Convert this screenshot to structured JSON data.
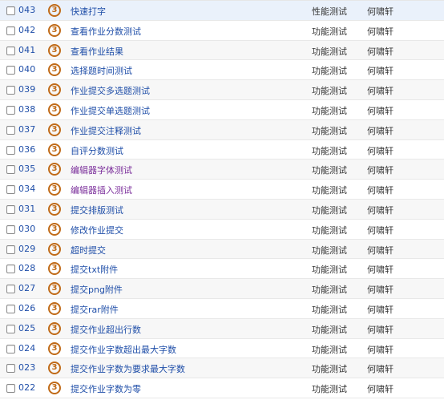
{
  "rows": [
    {
      "id": "043",
      "priority": "3",
      "title": "快速打字",
      "type": "性能测试",
      "owner": "何啸轩",
      "visited": false
    },
    {
      "id": "042",
      "priority": "3",
      "title": "查看作业分数测试",
      "type": "功能测试",
      "owner": "何啸轩",
      "visited": false
    },
    {
      "id": "041",
      "priority": "3",
      "title": "查看作业结果",
      "type": "功能测试",
      "owner": "何啸轩",
      "visited": false
    },
    {
      "id": "040",
      "priority": "3",
      "title": "选择题时间测试",
      "type": "功能测试",
      "owner": "何啸轩",
      "visited": false
    },
    {
      "id": "039",
      "priority": "3",
      "title": "作业提交多选题测试",
      "type": "功能测试",
      "owner": "何啸轩",
      "visited": false
    },
    {
      "id": "038",
      "priority": "3",
      "title": "作业提交单选题测试",
      "type": "功能测试",
      "owner": "何啸轩",
      "visited": false
    },
    {
      "id": "037",
      "priority": "3",
      "title": "作业提交注释测试",
      "type": "功能测试",
      "owner": "何啸轩",
      "visited": false
    },
    {
      "id": "036",
      "priority": "3",
      "title": "自评分数测试",
      "type": "功能测试",
      "owner": "何啸轩",
      "visited": false
    },
    {
      "id": "035",
      "priority": "3",
      "title": "编辑器字体测试",
      "type": "功能测试",
      "owner": "何啸轩",
      "visited": true
    },
    {
      "id": "034",
      "priority": "3",
      "title": "编辑器插入测试",
      "type": "功能测试",
      "owner": "何啸轩",
      "visited": true
    },
    {
      "id": "031",
      "priority": "3",
      "title": "提交排版测试",
      "type": "功能测试",
      "owner": "何啸轩",
      "visited": false
    },
    {
      "id": "030",
      "priority": "3",
      "title": "修改作业提交",
      "type": "功能测试",
      "owner": "何啸轩",
      "visited": false
    },
    {
      "id": "029",
      "priority": "3",
      "title": "超时提交",
      "type": "功能测试",
      "owner": "何啸轩",
      "visited": false
    },
    {
      "id": "028",
      "priority": "3",
      "title": "提交txt附件",
      "type": "功能测试",
      "owner": "何啸轩",
      "visited": false
    },
    {
      "id": "027",
      "priority": "3",
      "title": "提交png附件",
      "type": "功能测试",
      "owner": "何啸轩",
      "visited": false
    },
    {
      "id": "026",
      "priority": "3",
      "title": "提交rar附件",
      "type": "功能测试",
      "owner": "何啸轩",
      "visited": false
    },
    {
      "id": "025",
      "priority": "3",
      "title": "提交作业超出行数",
      "type": "功能测试",
      "owner": "何啸轩",
      "visited": false
    },
    {
      "id": "024",
      "priority": "3",
      "title": "提交作业字数超出最大字数",
      "type": "功能测试",
      "owner": "何啸轩",
      "visited": false
    },
    {
      "id": "023",
      "priority": "3",
      "title": "提交作业字数为要求最大字数",
      "type": "功能测试",
      "owner": "何啸轩",
      "visited": false
    },
    {
      "id": "022",
      "priority": "3",
      "title": "提交作业字数为零",
      "type": "功能测试",
      "owner": "何啸轩",
      "visited": false
    }
  ],
  "colors": {
    "link_blue": "#1f4ea8",
    "link_visited": "#7a2d9a",
    "priority_orange": "#c06a17",
    "row_alt": "#f7f7f7",
    "row_highlight": "#eaf1fb"
  }
}
